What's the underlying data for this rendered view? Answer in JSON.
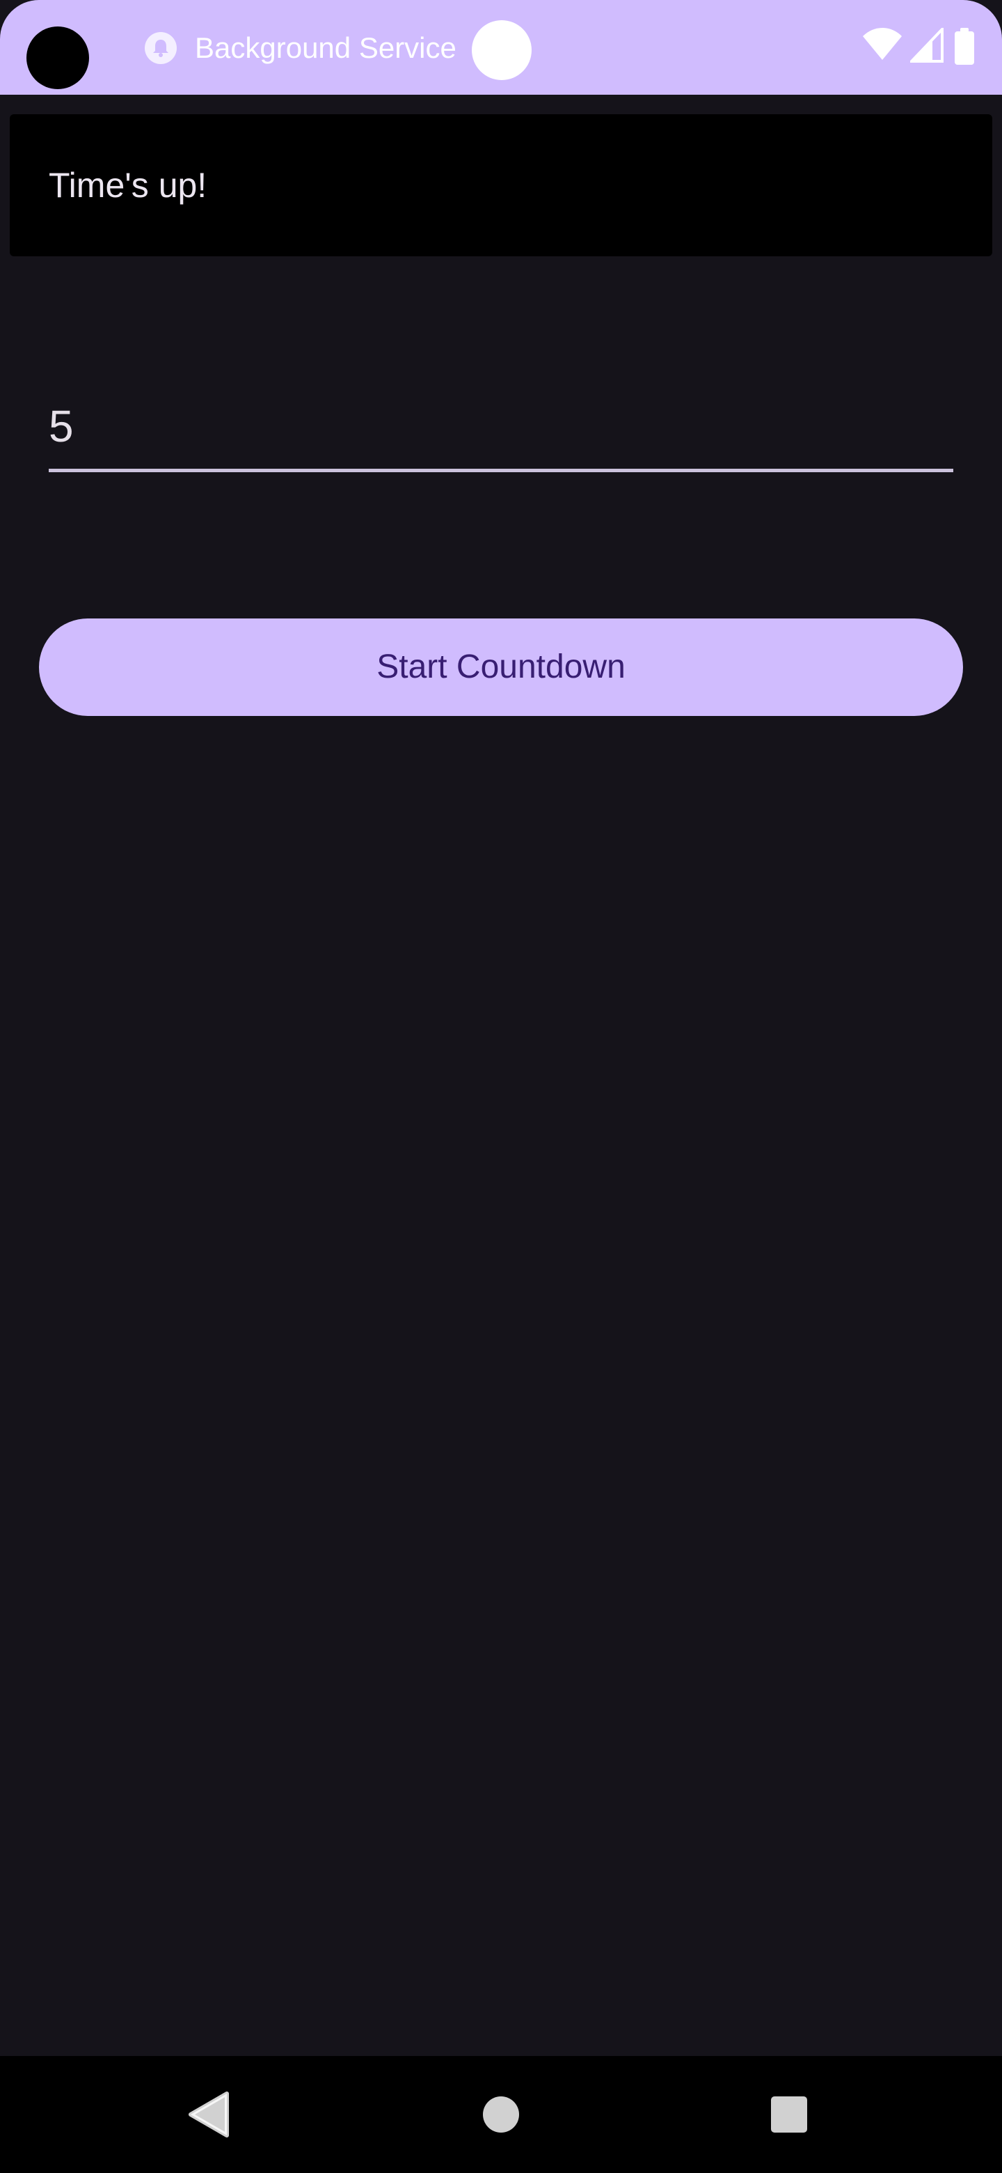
{
  "status_bar": {
    "title": "Background Service",
    "icons": [
      "notification-bell-icon",
      "wifi-icon",
      "cellular-signal-icon",
      "battery-icon"
    ]
  },
  "message": {
    "text": "Time's up!"
  },
  "countdown_input": {
    "value": "5"
  },
  "start_button": {
    "label": "Start Countdown"
  },
  "nav_bar": {
    "icons": [
      "back-icon",
      "home-icon",
      "recents-icon"
    ]
  },
  "colors": {
    "accent": "#d0bcfe",
    "on_accent": "#381e72",
    "background": "#15131a",
    "surface": "#000000",
    "text": "#e6e0e9"
  }
}
